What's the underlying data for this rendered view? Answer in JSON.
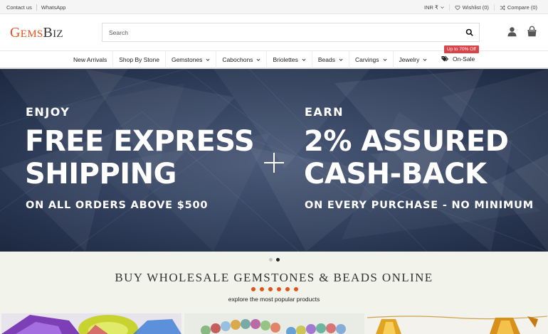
{
  "topbar": {
    "contact": "Contact us",
    "whatsapp": "WhatsApp",
    "currency": "INR ₹",
    "wishlist": "Wishlist (0)",
    "compare": "Compare (0)"
  },
  "header": {
    "logo_first": "G",
    "logo_part1": "EMS",
    "logo_part2": "B",
    "logo_part3": "IZ",
    "search_placeholder": "Search"
  },
  "nav": {
    "items": [
      {
        "label": "New Arrivals",
        "dropdown": false
      },
      {
        "label": "Shop By Stone",
        "dropdown": false
      },
      {
        "label": "Gemstones",
        "dropdown": true
      },
      {
        "label": "Cabochons",
        "dropdown": true
      },
      {
        "label": "Briolettes",
        "dropdown": true
      },
      {
        "label": "Beads",
        "dropdown": true
      },
      {
        "label": "Carvings",
        "dropdown": true
      },
      {
        "label": "Jewelry",
        "dropdown": true
      }
    ],
    "sale_badge": "Up to 70% Off",
    "on_sale": "On-Sale"
  },
  "hero": {
    "left": {
      "kicker": "ENJOY",
      "line1": "FREE EXPRESS",
      "line2": "SHIPPING",
      "sub": "ON ALL ORDERS ABOVE $500"
    },
    "right": {
      "kicker": "EARN",
      "line1": "2% ASSURED",
      "line2": "CASH-BACK",
      "sub": "ON EVERY PURCHASE - NO MINIMUM"
    },
    "slides": 2,
    "active_slide": 2
  },
  "section": {
    "title": "BUY WHOLESALE GEMSTONES & BEADS ONLINE",
    "subtitle": "explore the most popular products"
  },
  "colors": {
    "brand": "#e0531e",
    "sale": "#d9444a",
    "hero_bg": "#2c3a55"
  }
}
